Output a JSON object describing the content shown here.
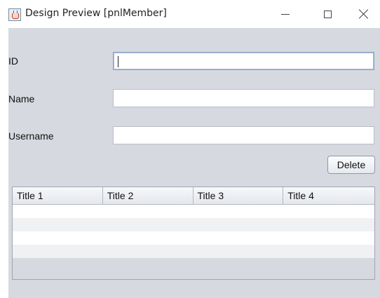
{
  "window": {
    "title": "Design Preview [pnlMember]",
    "icon": "java-cup-icon"
  },
  "form": {
    "id_label": "ID",
    "id_value": "",
    "name_label": "Name",
    "name_value": "",
    "username_label": "Username",
    "username_value": ""
  },
  "toolbar": {
    "delete_label": "Delete"
  },
  "table": {
    "columns": [
      "Title 1",
      "Title 2",
      "Title 3",
      "Title 4"
    ],
    "rows": [
      [
        "",
        "",
        "",
        ""
      ],
      [
        "",
        "",
        "",
        ""
      ],
      [
        "",
        "",
        "",
        ""
      ],
      [
        "",
        "",
        "",
        ""
      ]
    ]
  },
  "colors": {
    "panel_background": "#d6d9df",
    "focus_border": "#8aa3c4"
  }
}
